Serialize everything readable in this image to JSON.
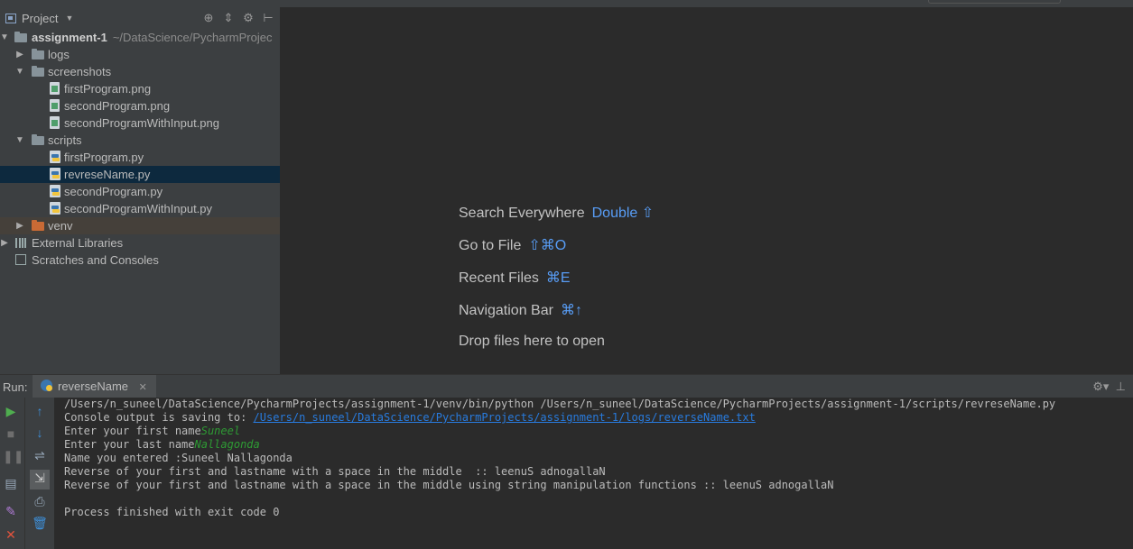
{
  "project_panel": {
    "title": "Project",
    "tools": [
      "⊕",
      "⇕",
      "⚙",
      "⊢"
    ],
    "tree": {
      "root": {
        "name": "assignment-1",
        "path": "~/DataScience/PycharmProjec"
      },
      "logs": "logs",
      "screenshots": "screenshots",
      "screenshot_files": [
        "firstProgram.png",
        "secondProgram.png",
        "secondProgramWithInput.png"
      ],
      "scripts": "scripts",
      "script_files": [
        "firstProgram.py",
        "revreseName.py",
        "secondProgram.py",
        "secondProgramWithInput.py"
      ],
      "venv": "venv",
      "external_libraries": "External Libraries",
      "scratches": "Scratches and Consoles"
    }
  },
  "editor_hints": [
    {
      "label": "Search Everywhere",
      "key": "Double ⇧"
    },
    {
      "label": "Go to File",
      "key": "⇧⌘O"
    },
    {
      "label": "Recent Files",
      "key": "⌘E"
    },
    {
      "label": "Navigation Bar",
      "key": "⌘↑"
    },
    {
      "label": "Drop files here to open",
      "key": ""
    }
  ],
  "run_panel": {
    "label": "Run:",
    "tab": "reverseName",
    "console": {
      "command": "/Users/n_suneel/DataScience/PycharmProjects/assignment-1/venv/bin/python /Users/n_suneel/DataScience/PycharmProjects/assignment-1/scripts/revreseName.py",
      "saving_prefix": "Console output is saving to: ",
      "saving_link": "/Users/n_suneel/DataScience/PycharmProjects/assignment-1/logs/reverseName.txt",
      "first_prompt": "Enter your first name",
      "first_input": "Suneel",
      "last_prompt": "Enter your last name",
      "last_input": "Nallagonda",
      "entered": "Name you entered :Suneel Nallagonda",
      "reverse1": "Reverse of your first and lastname with a space in the middle  :: leenuS adnogallaN",
      "reverse2": "Reverse of your first and lastname with a space in the middle using string manipulation functions :: leenuS adnogallaN",
      "finished": "Process finished with exit code 0"
    }
  },
  "colors": {
    "panel": "#3c3f41",
    "editor": "#2b2b2b",
    "accent_key": "#589df6",
    "link": "#287bde",
    "input": "#2e9b34",
    "selection": "#0d293e"
  }
}
